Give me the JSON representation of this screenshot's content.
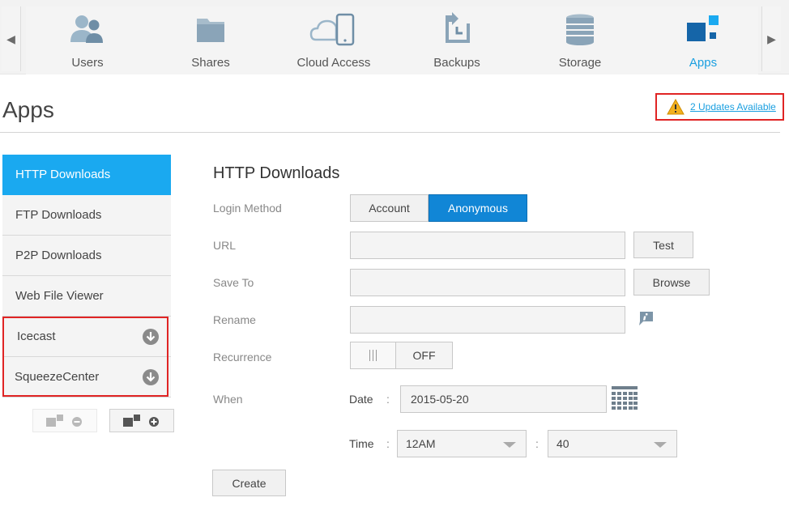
{
  "nav": {
    "items": [
      {
        "label": "Users",
        "icon": "users-icon"
      },
      {
        "label": "Shares",
        "icon": "folder-icon"
      },
      {
        "label": "Cloud Access",
        "icon": "cloud-phone-icon"
      },
      {
        "label": "Backups",
        "icon": "backup-icon"
      },
      {
        "label": "Storage",
        "icon": "storage-icon"
      },
      {
        "label": "Apps",
        "icon": "apps-icon"
      }
    ],
    "active": "Apps",
    "left_arrow": "◀",
    "right_arrow": "▶"
  },
  "page": {
    "title": "Apps",
    "updates_link": "2 Updates Available"
  },
  "sidebar": {
    "items": [
      {
        "label": "HTTP Downloads"
      },
      {
        "label": "FTP Downloads"
      },
      {
        "label": "P2P Downloads"
      },
      {
        "label": "Web File Viewer"
      },
      {
        "label": "Icecast"
      },
      {
        "label": "SqueezeCenter"
      }
    ]
  },
  "form": {
    "title": "HTTP Downloads",
    "login_method_label": "Login Method",
    "login_options": [
      "Account",
      "Anonymous"
    ],
    "login_selected": "Anonymous",
    "url_label": "URL",
    "url_value": "",
    "test_label": "Test",
    "save_to_label": "Save To",
    "save_to_value": "",
    "browse_label": "Browse",
    "rename_label": "Rename",
    "rename_value": "",
    "recurrence_label": "Recurrence",
    "recurrence_state": "OFF",
    "when_label": "When",
    "date_label": "Date",
    "date_value": "2015-05-20",
    "time_label": "Time",
    "time_hour": "12AM",
    "time_minute": "40",
    "colon": ":",
    "create_label": "Create"
  },
  "colors": {
    "accent": "#1aa9f0",
    "selected_button": "#1186d6",
    "highlight_box": "#e02424",
    "link": "#1a9fe0"
  }
}
